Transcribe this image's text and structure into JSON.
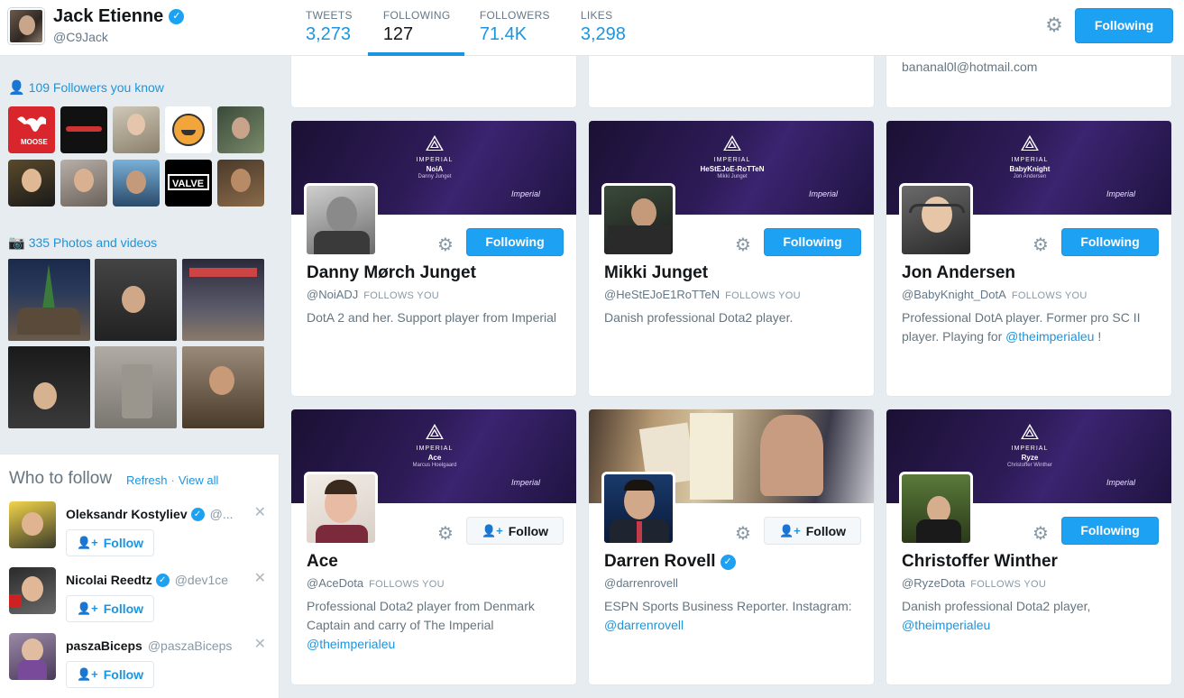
{
  "profile": {
    "name": "Jack Etienne",
    "handle": "@C9Jack",
    "following_button": "Following"
  },
  "stats": [
    {
      "label": "TWEETS",
      "value": "3,273"
    },
    {
      "label": "FOLLOWING",
      "value": "127"
    },
    {
      "label": "FOLLOWERS",
      "value": "71.4K"
    },
    {
      "label": "LIKES",
      "value": "3,298"
    }
  ],
  "sidebar": {
    "followers_you_know": "109 Followers you know",
    "photos_videos": "335 Photos and videos"
  },
  "who_to_follow": {
    "title": "Who to follow",
    "refresh": "Refresh",
    "dot": "·",
    "view_all": "View all",
    "follow_label": "Follow",
    "users": [
      {
        "name": "Oleksandr Kostyliev",
        "handle": "@...",
        "verified": true
      },
      {
        "name": "Nicolai Reedtz",
        "handle": "@dev1ce",
        "verified": true
      },
      {
        "name": "paszaBiceps",
        "handle": "@paszaBiceps",
        "verified": false
      }
    ]
  },
  "top_partial": {
    "email": "bananal0l@hotmail.com"
  },
  "cards": [
    {
      "banner_tag": "NoiA",
      "banner_real": "Danny Junget",
      "name": "Danny Mørch Junget",
      "handle": "@NoiADJ",
      "follows_you": "FOLLOWS YOU",
      "bio": "DotA 2 and her. Support player from Imperial",
      "mention": "",
      "bio_tail": "",
      "button": "Following"
    },
    {
      "banner_tag": "HeStEJoE-RoTTeN",
      "banner_real": "Mikki Junget",
      "name": "Mikki Junget",
      "handle": "@HeStEJoE1RoTTeN",
      "follows_you": "FOLLOWS YOU",
      "bio": "Danish professional Dota2 player.",
      "mention": "",
      "bio_tail": "",
      "button": "Following"
    },
    {
      "banner_tag": "BabyKnight",
      "banner_real": "Jon Andersen",
      "name": "Jon Andersen",
      "handle": "@BabyKnight_DotA",
      "follows_you": "FOLLOWS YOU",
      "bio": "Professional DotA player. Former pro SC II player. Playing for ",
      "mention": "@theimperialeu",
      "bio_tail": " !",
      "button": "Following"
    },
    {
      "banner_tag": "Ace",
      "banner_real": "Marcus Hoelgaard",
      "name": "Ace",
      "handle": "@AceDota",
      "follows_you": "FOLLOWS YOU",
      "bio": "Professional Dota2 player from Denmark Captain and carry of The Imperial ",
      "mention": "@theimperialeu",
      "bio_tail": "",
      "button": "Follow"
    },
    {
      "banner_tag": "",
      "banner_real": "",
      "name": "Darren Rovell",
      "handle": "@darrenrovell",
      "follows_you": "",
      "bio": "ESPN Sports Business Reporter. Instagram: ",
      "mention": "@darrenrovell",
      "bio_tail": "",
      "button": "Follow"
    },
    {
      "banner_tag": "Ryze",
      "banner_real": "Christoffer Winther",
      "name": "Christoffer Winther",
      "handle": "@RyzeDota",
      "follows_you": "FOLLOWS YOU",
      "bio": "Danish professional Dota2 player, ",
      "mention": "@theimperialeu",
      "bio_tail": "",
      "button": "Following"
    }
  ],
  "banner": {
    "brand": "IMPERIAL",
    "sig": "Imperial"
  }
}
